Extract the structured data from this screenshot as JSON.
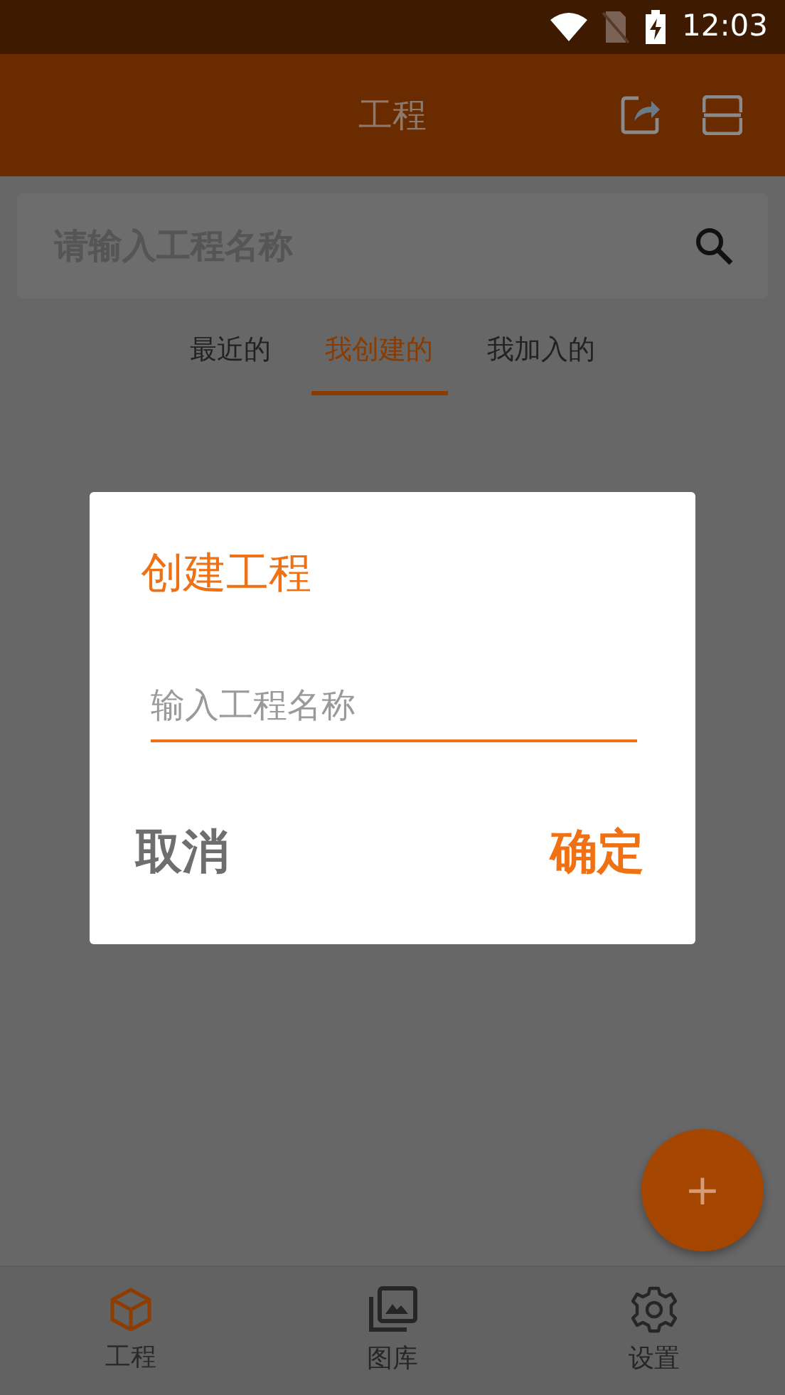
{
  "status_bar": {
    "time": "12:03"
  },
  "app_bar": {
    "title": "工程"
  },
  "search": {
    "placeholder": "请输入工程名称"
  },
  "tabs": [
    {
      "label": "最近的",
      "selected": false
    },
    {
      "label": "我创建的",
      "selected": true
    },
    {
      "label": "我加入的",
      "selected": false
    }
  ],
  "dialog": {
    "title": "创建工程",
    "input": {
      "placeholder": "输入工程名称"
    },
    "buttons": [
      {
        "label": "取消",
        "kind": "cancel"
      },
      {
        "label": "确定",
        "kind": "confirm"
      }
    ]
  },
  "fab": {
    "label": "+"
  },
  "bottom_nav": [
    {
      "label": "工程",
      "selected": true
    },
    {
      "label": "图库",
      "selected": false
    },
    {
      "label": "设置",
      "selected": false
    }
  ]
}
